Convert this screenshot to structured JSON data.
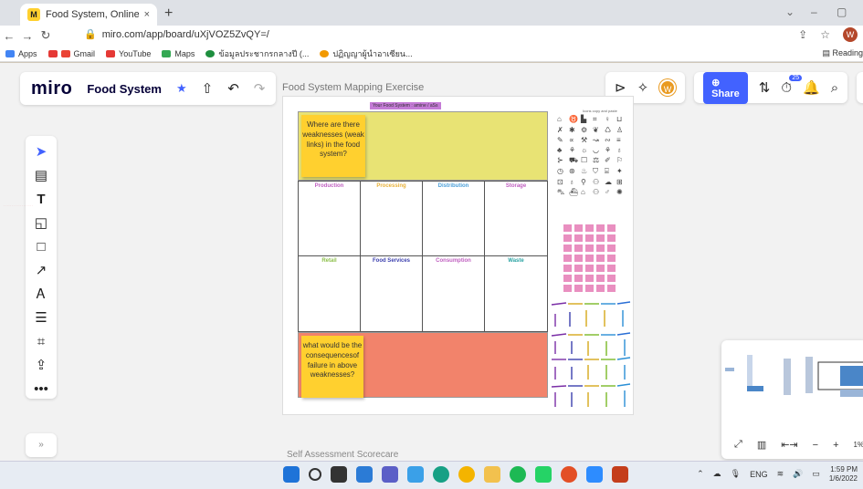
{
  "browser": {
    "tab_title": "Food System, Online Whiteboard",
    "tab_close": "×",
    "new_tab": "+",
    "url": "miro.com/app/board/uXjVOZ5ZvQY=/",
    "bookmarks": [
      "Apps",
      "Gmail",
      "YouTube",
      "Maps",
      "ข้อมูลประชากรกลางปี (...",
      "ปฏิญญาผู้นำอาเซียน..."
    ],
    "reading_list": "Reading",
    "profile_initial": "W"
  },
  "miro": {
    "logo": "miro",
    "board_name": "Food System",
    "share_label": "Share",
    "avatar_initial": "W",
    "notification_count": "25",
    "frame_title": "Food System Mapping Exercise",
    "frame_label": "Your Food System : amine / aSs",
    "second_frame_title": "Self Assessment Scorecare",
    "icons_caption": "Icons copy and paste",
    "sticky_question": "Where are there weaknesses (weak links) in the food system?",
    "sticky_consequence": "what would be the consequencesof failure in above weaknesses?",
    "row1": [
      {
        "label": "Production",
        "color": "#c060c0"
      },
      {
        "label": "Processing",
        "color": "#e9b23a"
      },
      {
        "label": "Distribution",
        "color": "#4a9fd8"
      },
      {
        "label": "Storage",
        "color": "#c060c0"
      }
    ],
    "row2": [
      {
        "label": "Retail",
        "color": "#8cbf4a"
      },
      {
        "label": "Food Services",
        "color": "#3b3fae"
      },
      {
        "label": "Consumption",
        "color": "#c060c0"
      },
      {
        "label": "Waste",
        "color": "#2aa3a3"
      }
    ],
    "zoom": "1%"
  },
  "taskbar": {
    "lang": "ENG",
    "time": "1:59 PM",
    "date": "1/6/2022"
  }
}
